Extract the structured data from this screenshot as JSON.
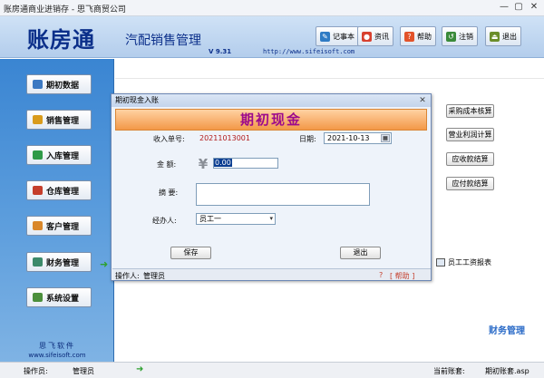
{
  "window": {
    "title": "账房通商业进销存 - 思飞商贸公司",
    "minimize_glyph": "—",
    "maximize_glyph": "▢",
    "close_glyph": "✕"
  },
  "header": {
    "logo": "账房通",
    "subtitle": "汽配销售管理",
    "version": "V 9.31",
    "website": "http://www.sifeisoft.com",
    "toolbar": [
      {
        "label": "记事本",
        "icon": "notepad-icon",
        "color": "#2f7bc4"
      },
      {
        "label": "资讯",
        "icon": "news-icon",
        "color": "#d8412f"
      },
      {
        "label": "帮助",
        "icon": "help-icon",
        "color": "#e2532a"
      },
      {
        "label": "注销",
        "icon": "logout-icon",
        "color": "#3a8a3a"
      },
      {
        "label": "退出",
        "icon": "exit-icon",
        "color": "#6a8d2a"
      }
    ]
  },
  "sidebar": {
    "items": [
      {
        "label": "期初数据",
        "icon": "book-icon",
        "color": "#3c79c2"
      },
      {
        "label": "销售管理",
        "icon": "sales-icon",
        "color": "#d99b1c"
      },
      {
        "label": "入库管理",
        "icon": "stock-in-icon",
        "color": "#2f9a48"
      },
      {
        "label": "仓库管理",
        "icon": "warehouse-icon",
        "color": "#c53e2b"
      },
      {
        "label": "客户管理",
        "icon": "customer-icon",
        "color": "#d9872a"
      },
      {
        "label": "财务管理",
        "icon": "finance-icon",
        "color": "#3c8a6a"
      },
      {
        "label": "系统设置",
        "icon": "settings-icon",
        "color": "#4b8f3c"
      }
    ],
    "arrow": "➜",
    "brand": "思飞软件",
    "url": "www.sifeisoft.com"
  },
  "main": {
    "right_buttons": [
      "采购成本核算",
      "营业利润计算",
      "应收款结算",
      "应付款结算"
    ],
    "payroll_button": "员工工资报表",
    "module_label": "财务管理"
  },
  "dialog": {
    "title": "期初现金入账",
    "close_glyph": "✕",
    "banner": "期初现金",
    "receipt_label": "收入单号:",
    "receipt_value": "20211013001",
    "date_label": "日期:",
    "date_value": "2021-10-13",
    "amount_label": "金 额:",
    "amount_value": "0.00",
    "memo_label": "摘 要:",
    "handler_label": "经办人:",
    "handler_value": "员工一",
    "save_label": "保存",
    "exit_label": "退出",
    "status_operator_label": "操作人:",
    "status_operator_value": "管理员",
    "help_label": "[ 帮助 ]"
  },
  "statusbar": {
    "operator_label": "操作员:",
    "operator_value": "管理员",
    "account_label": "当前账套:",
    "account_value": "期初账套.asp"
  }
}
